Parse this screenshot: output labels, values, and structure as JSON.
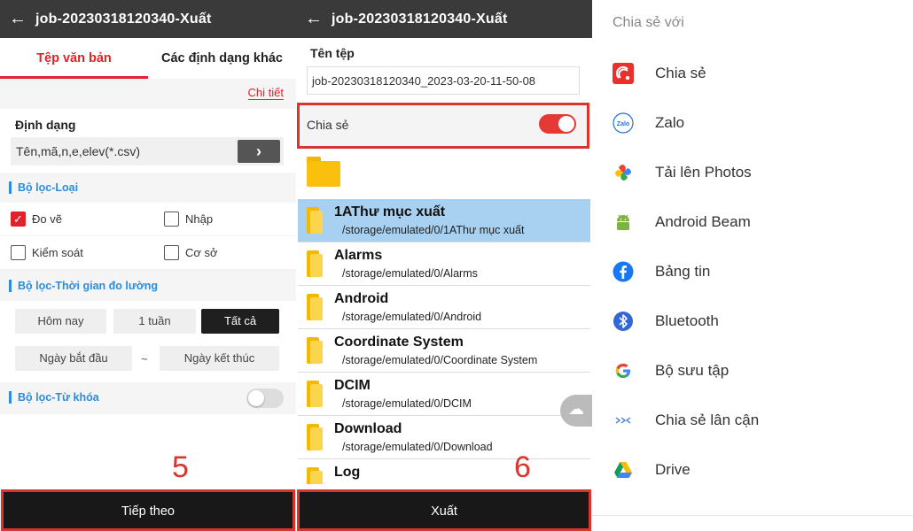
{
  "panel1": {
    "title": "job-20230318120340-Xuất",
    "tabs": [
      "Tệp văn bản",
      "Các định dạng khác"
    ],
    "detail_link": "Chi tiết",
    "format_label": "Định dạng",
    "format_value": "Tên,mã,n,e,elev(*.csv)",
    "filter_type_label": "Bộ lọc-Loại",
    "checkboxes": [
      {
        "label": "Đo vẽ",
        "checked": true
      },
      {
        "label": "Nhập",
        "checked": false
      },
      {
        "label": "Kiểm soát",
        "checked": false
      },
      {
        "label": "Cơ sở",
        "checked": false
      }
    ],
    "filter_time_label": "Bộ lọc-Thời gian đo lường",
    "time_buttons": [
      "Hôm nay",
      "1 tuần",
      "Tất cả"
    ],
    "start_date": "Ngày bắt đầu",
    "range_sep": "~",
    "end_date": "Ngày kết thúc",
    "filter_keyword_label": "Bộ lọc-Từ khóa",
    "keyword_toggle_on": false,
    "step_number": "5",
    "next_button": "Tiếp theo"
  },
  "panel2": {
    "title": "job-20230318120340-Xuất",
    "filename_label": "Tên tệp",
    "filename_value": "job-20230318120340_2023-03-20-11-50-08",
    "share_label": "Chia sẻ",
    "share_toggle_on": true,
    "folders": [
      {
        "name": "1AThư mục xuất",
        "path": "/storage/emulated/0/1AThư mục xuất",
        "selected": true
      },
      {
        "name": "Alarms",
        "path": "/storage/emulated/0/Alarms",
        "selected": false
      },
      {
        "name": "Android",
        "path": "/storage/emulated/0/Android",
        "selected": false
      },
      {
        "name": "Coordinate System",
        "path": "/storage/emulated/0/Coordinate System",
        "selected": false
      },
      {
        "name": "DCIM",
        "path": "/storage/emulated/0/DCIM",
        "selected": false
      },
      {
        "name": "Download",
        "path": "/storage/emulated/0/Download",
        "selected": false
      },
      {
        "name": "Log",
        "path": "",
        "selected": false
      }
    ],
    "step_number": "6",
    "export_button": "Xuất"
  },
  "panel3": {
    "title": "Chia sẻ với",
    "apps": [
      {
        "label": "Chia sẻ",
        "icon": "share-app-icon"
      },
      {
        "label": "Zalo",
        "icon": "zalo-icon"
      },
      {
        "label": "Tải lên Photos",
        "icon": "photos-icon"
      },
      {
        "label": "Android Beam",
        "icon": "android-icon"
      },
      {
        "label": "Bảng tin",
        "icon": "facebook-icon"
      },
      {
        "label": "Bluetooth",
        "icon": "bluetooth-icon"
      },
      {
        "label": "Bộ sưu tập",
        "icon": "google-icon"
      },
      {
        "label": "Chia sẻ lân cận",
        "icon": "nearby-share-icon"
      },
      {
        "label": "Drive",
        "icon": "drive-icon"
      }
    ]
  },
  "colors": {
    "accent": "#e0232b",
    "section_blue": "#2a8de0",
    "topbar": "#3a3a3a",
    "selected_row": "#a8d0f0",
    "annotation_red": "#d8352c"
  }
}
